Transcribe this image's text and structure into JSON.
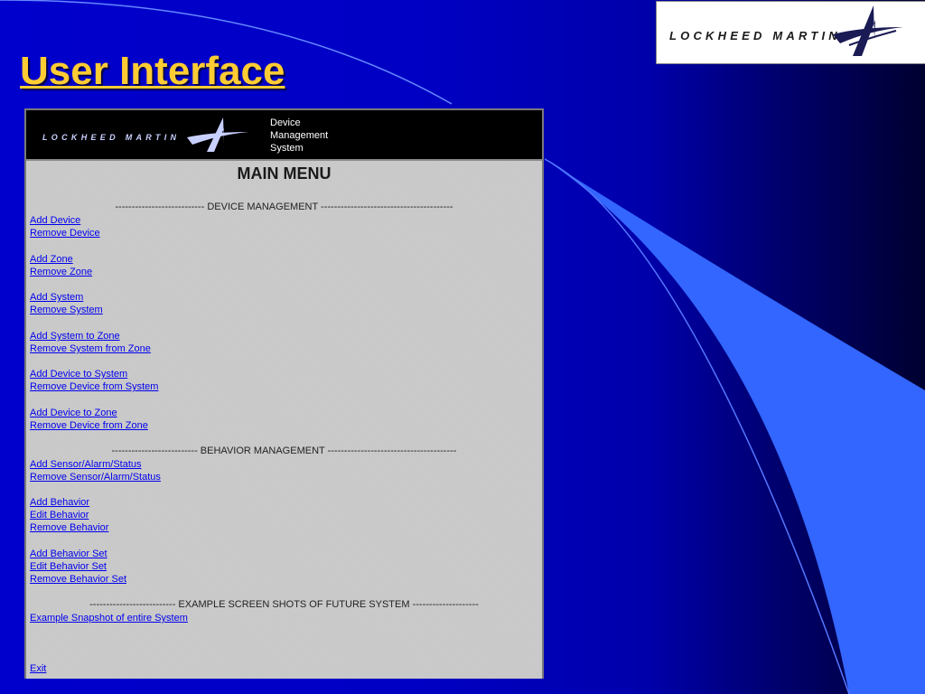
{
  "slide": {
    "title": "User Interface",
    "logo_text": "LOCKHEED MARTIN"
  },
  "app": {
    "logo_text": "LOCKHEED MARTIN",
    "name_lines": [
      "Device",
      "Management",
      "System"
    ],
    "menu_title": "MAIN MENU",
    "sections": [
      {
        "header": "--------------------------- DEVICE MANAGEMENT ----------------------------------------"
      },
      {
        "header": "-------------------------- BEHAVIOR MANAGEMENT ---------------------------------------"
      },
      {
        "header": "-------------------------- EXAMPLE SCREEN SHOTS OF FUTURE SYSTEM --------------------"
      }
    ],
    "links": {
      "add_device": "Add Device",
      "remove_device": "Remove Device",
      "add_zone": "Add Zone",
      "remove_zone": "Remove Zone",
      "add_system": "Add System",
      "remove_system": "Remove System",
      "add_system_to_zone": "Add System to Zone",
      "remove_system_from_zone": "Remove System from Zone",
      "add_device_to_system": "Add Device to System",
      "remove_device_from_system": "Remove Device from System",
      "add_device_to_zone": "Add Device to Zone",
      "remove_device_from_zone": "Remove Device from Zone",
      "add_sensor": "Add Sensor/Alarm/Status",
      "remove_sensor": "Remove Sensor/Alarm/Status",
      "add_behavior": "Add Behavior",
      "edit_behavior": "Edit Behavior",
      "remove_behavior": "Remove Behavior",
      "add_behavior_set": "Add Behavior Set",
      "edit_behavior_set": "Edit Behavior Set",
      "remove_behavior_set": "Remove Behavior Set",
      "example_snapshot": "Example Snapshot of entire System",
      "exit": "Exit"
    }
  },
  "colors": {
    "background": "#0000cc",
    "title": "#ffcc33",
    "link": "#0000ee",
    "panel": "#c8c8c8"
  }
}
